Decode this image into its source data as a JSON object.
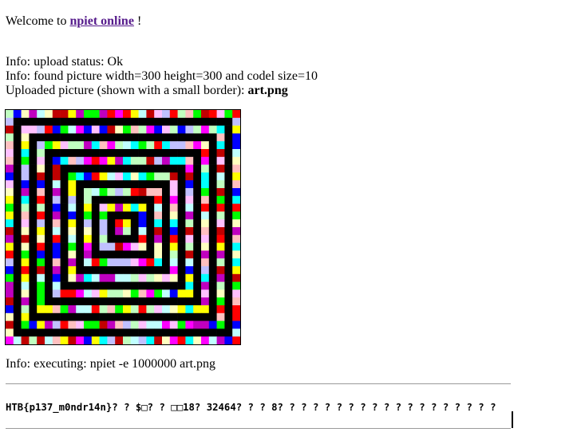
{
  "welcome": {
    "prefix": "Welcome to",
    "link": "npiet online",
    "suffix": "!"
  },
  "info": {
    "upload_status": "Info: upload status: Ok",
    "found_picture": "Info: found picture width=300 height=300 and codel size=10",
    "uploaded_prefix": "Uploaded picture (shown with a small border):",
    "filename": "art.png"
  },
  "picture": {
    "codels_per_side": 30,
    "palette": {
      "black": "#000000",
      "white": "#ffffff",
      "colors": [
        "#ff0000",
        "#ffff00",
        "#00ff00",
        "#00ffff",
        "#0000ff",
        "#ff00ff",
        "#ffc0c0",
        "#ffffc0",
        "#c0ffc0",
        "#c0ffff",
        "#c0c0ff",
        "#ffc0ff",
        "#c00000",
        "#c000c0"
      ]
    }
  },
  "execution": {
    "line": "Info: executing: npiet -e 1000000 art.png",
    "output": "HTB{p137_m0ndr14n}? ? $□? ? □□18? 32464? ? ? 8? ? ? ? ? ? ? ? ? ? ? ? ? ? ? ? ? ? ?"
  }
}
